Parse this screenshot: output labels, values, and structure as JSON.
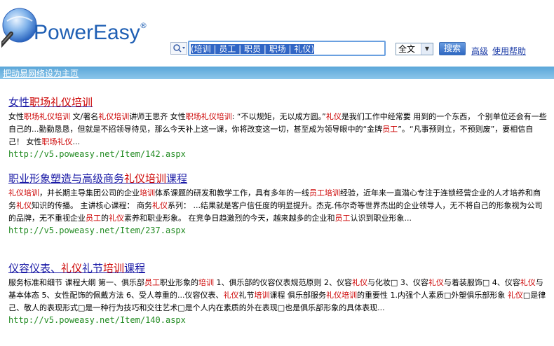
{
  "brand": {
    "name": "PowerEasy",
    "reg": "®"
  },
  "search": {
    "query": "(培训 | 员工 | 职员 | 职场 | 礼仪)",
    "scope": "全文",
    "button": "搜索"
  },
  "header_links": {
    "advanced": "高级",
    "help": "使用帮助"
  },
  "bar": {
    "set_homepage": "把动易网络设为主页"
  },
  "results": [
    {
      "title_parts": [
        "女性",
        "职场礼仪培训",
        ""
      ],
      "snippet": [
        [
          "女性",
          false
        ],
        [
          "职场礼仪培训",
          true
        ],
        [
          " 文/著名",
          false
        ],
        [
          "礼仪培训",
          true
        ],
        [
          "讲师王思齐 女性",
          false
        ],
        [
          "职场礼仪培训",
          true
        ],
        [
          ":  “不以规矩，无以成方圆。”",
          false
        ],
        [
          "礼仪",
          true
        ],
        [
          "是我们工作中经常要 用到的一个东西， 个别单位还会有一些自己的...勤勤恳恳，但就是不招领导待见，那么今天补上这一课，你将改变这一切，甚至成为领导眼中的“金牌",
          false
        ],
        [
          "员工",
          true
        ],
        [
          "”。“凡事预则立，不预则废”，要相信自己！ 女性",
          false
        ],
        [
          "职场礼仪",
          true
        ],
        [
          "...",
          false
        ]
      ],
      "url": "http://v5.poweasy.net/Item/142.aspx"
    },
    {
      "title_parts": [
        "职业形象塑造与高级商务",
        "礼仪培训",
        "课程"
      ],
      "snippet": [
        [
          "礼仪培训",
          true
        ],
        [
          "，并长期主导集团公司的企业",
          false
        ],
        [
          "培训",
          true
        ],
        [
          "体系课题的研发和教学工作，具有多年的一线",
          false
        ],
        [
          "员工培训",
          true
        ],
        [
          "经验，近年来一直潜心专注于连锁经营企业的人才培养和商务",
          false
        ],
        [
          "礼仪",
          true
        ],
        [
          "知识的传播。 主讲核心课程： 商务",
          false
        ],
        [
          "礼仪",
          true
        ],
        [
          "系列： ...结果就是客户信任度的明显提升。杰克.伟尔奇等世界杰出的企业领导人，无不将自己的形象视为公司的品牌，无不重视企业",
          false
        ],
        [
          "员工",
          true
        ],
        [
          "的",
          false
        ],
        [
          "礼仪",
          true
        ],
        [
          "素养和职业形象。       在竞争日趋激烈的今天，越来越多的企业和",
          false
        ],
        [
          "员工",
          true
        ],
        [
          "认识到职业形象...",
          false
        ]
      ],
      "url": "http://v5.poweasy.net/Item/237.aspx"
    },
    {
      "title_parts": [
        "仪容仪表、",
        "礼仪",
        "礼节",
        "培训",
        "课程"
      ],
      "snippet": [
        [
          "服务标准和细节 课程大纲 第一、俱乐部",
          false
        ],
        [
          "员工",
          true
        ],
        [
          "职业形象的",
          false
        ],
        [
          "培训",
          true
        ],
        [
          " 1、俱乐部的仪容仪表规范原则 2、仪容",
          false
        ],
        [
          "礼仪",
          true
        ],
        [
          "与化妆□ 3、仪容",
          false
        ],
        [
          "礼仪",
          true
        ],
        [
          "与着装服饰□ 4、仪容",
          false
        ],
        [
          "礼仪",
          true
        ],
        [
          "与基本体态 5、女性配饰的佩戴方法 6、受人尊重的...仪容仪表、",
          false
        ],
        [
          "礼仪",
          true
        ],
        [
          "礼节",
          false
        ],
        [
          "培训",
          true
        ],
        [
          "课程 俱乐部服务",
          false
        ],
        [
          "礼仪培训",
          true
        ],
        [
          "的重要性 1.内强个人素质□外塑俱乐部形象 ",
          false
        ],
        [
          "礼仪",
          true
        ],
        [
          "□是律己、敬人的表现形式□是一种行为技巧和交往艺术□是个人内在素质的外在表现□也是俱乐部形象的具体表现...",
          false
        ]
      ],
      "url": "http://v5.poweasy.net/Item/140.aspx"
    }
  ]
}
